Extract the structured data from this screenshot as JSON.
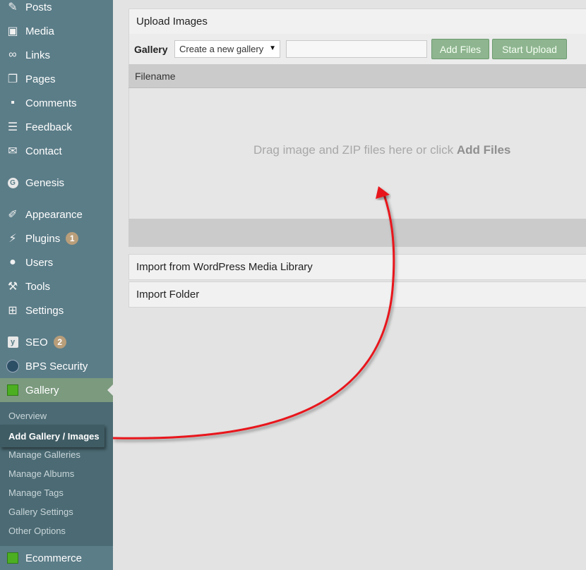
{
  "sidebar": {
    "items": [
      {
        "label": "Posts",
        "icon": "pin-icon"
      },
      {
        "label": "Media",
        "icon": "media-icon"
      },
      {
        "label": "Links",
        "icon": "link-icon"
      },
      {
        "label": "Pages",
        "icon": "pages-icon"
      },
      {
        "label": "Comments",
        "icon": "comment-icon"
      },
      {
        "label": "Feedback",
        "icon": "feedback-icon"
      },
      {
        "label": "Contact",
        "icon": "mail-icon"
      },
      {
        "label": "Genesis",
        "icon": "genesis-icon"
      },
      {
        "label": "Appearance",
        "icon": "brush-icon"
      },
      {
        "label": "Plugins",
        "icon": "plugin-icon",
        "badge": "1"
      },
      {
        "label": "Users",
        "icon": "user-icon"
      },
      {
        "label": "Tools",
        "icon": "wrench-icon"
      },
      {
        "label": "Settings",
        "icon": "settings-icon"
      },
      {
        "label": "SEO",
        "icon": "yoast-icon",
        "badge": "2"
      },
      {
        "label": "BPS Security",
        "icon": "shield-icon"
      },
      {
        "label": "Gallery",
        "icon": "gallery-icon"
      },
      {
        "label": "Ecommerce",
        "icon": "ecommerce-icon"
      }
    ],
    "submenu": [
      "Overview",
      "Add Gallery / Images",
      "Manage Galleries",
      "Manage Albums",
      "Manage Tags",
      "Gallery Settings",
      "Other Options"
    ]
  },
  "upload": {
    "title": "Upload Images",
    "gallery_label": "Gallery",
    "gallery_select_value": "Create a new gallery",
    "add_files_label": "Add Files",
    "start_upload_label": "Start Upload",
    "filename_header": "Filename",
    "drop_text": "Drag image and ZIP files here or click",
    "drop_text_strong": "Add Files"
  },
  "sections": {
    "import_media": "Import from WordPress Media Library",
    "import_folder": "Import Folder"
  },
  "colors": {
    "sidebar": "#5b7d88",
    "submenu": "#4b6a73",
    "button": "#8eb58f",
    "arrow": "#e8141b"
  }
}
